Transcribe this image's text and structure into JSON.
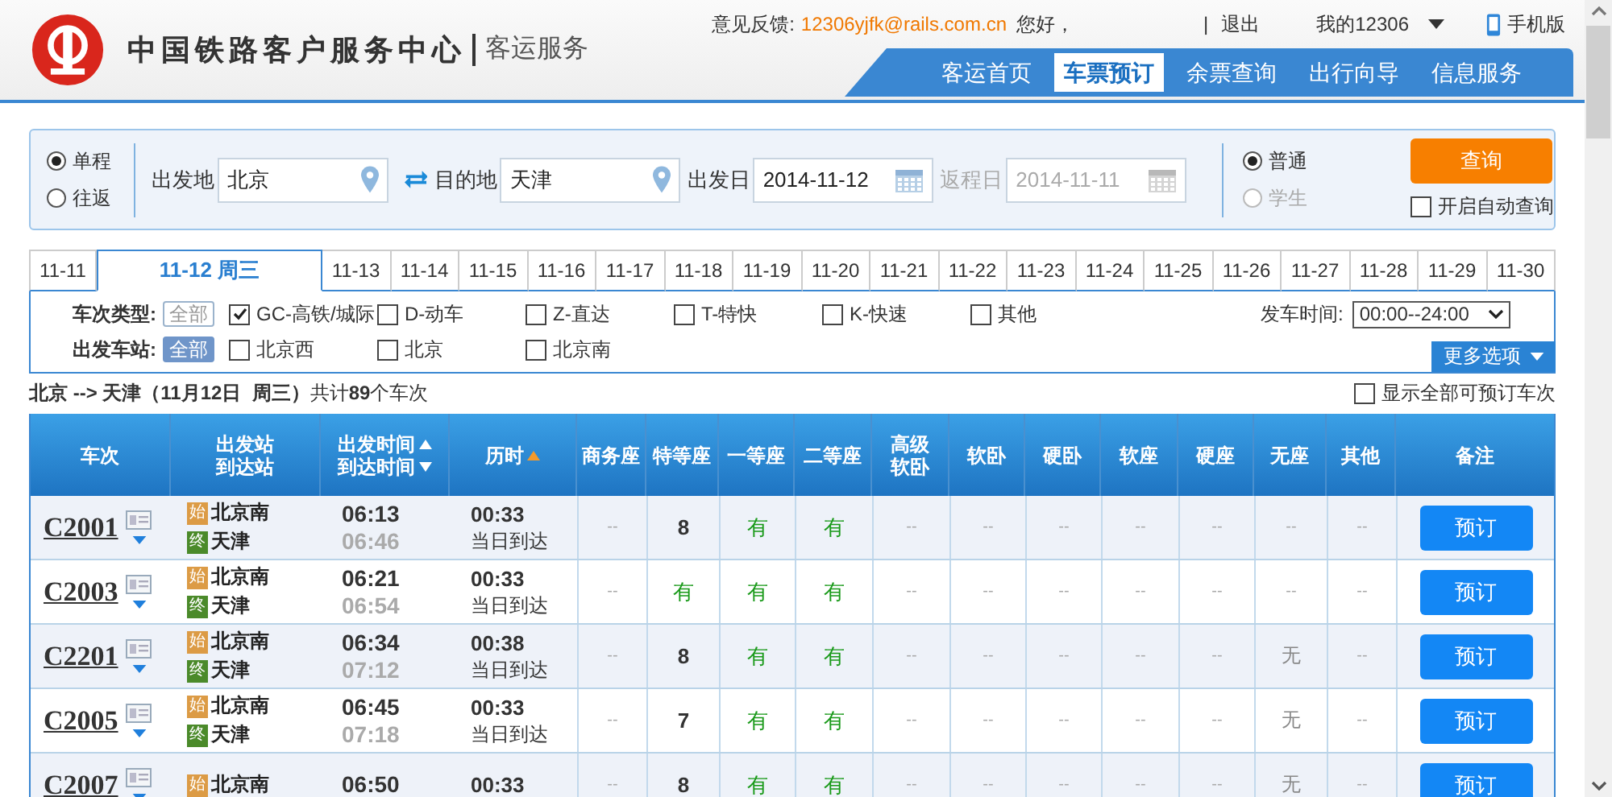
{
  "header": {
    "logo_title": "中国铁路客户服务中心",
    "logo_subtitle": "客运服务",
    "feedback_label": "意见反馈:",
    "feedback_email": "12306yjfk@rails.com.cn",
    "greeting": "您好，",
    "separator": "|",
    "logout": "退出",
    "my_account": "我的12306",
    "mobile": "手机版"
  },
  "nav": [
    {
      "label": "客运首页",
      "selected": false
    },
    {
      "label": "车票预订",
      "selected": true
    },
    {
      "label": "余票查询",
      "selected": false
    },
    {
      "label": "出行向导",
      "selected": false
    },
    {
      "label": "信息服务",
      "selected": false
    }
  ],
  "search": {
    "trip_types": [
      {
        "label": "单程",
        "selected": true
      },
      {
        "label": "往返",
        "selected": false
      }
    ],
    "from": {
      "label": "出发地",
      "value": "北京"
    },
    "to": {
      "label": "目的地",
      "value": "天津"
    },
    "depart_date": {
      "label": "出发日",
      "value": "2014-11-12",
      "disabled": false
    },
    "return_date": {
      "label": "返程日",
      "value": "2014-11-11",
      "disabled": true
    },
    "passenger_types": [
      {
        "label": "普通",
        "selected": true,
        "disabled": false
      },
      {
        "label": "学生",
        "selected": false,
        "disabled": true
      }
    ],
    "query_button": "查询",
    "auto_query": {
      "label": "开启自动查询",
      "checked": false
    }
  },
  "date_tabs": [
    {
      "label": "11-11",
      "selected": false
    },
    {
      "label": "11-12 周三",
      "selected": true
    },
    {
      "label": "11-13",
      "selected": false
    },
    {
      "label": "11-14",
      "selected": false
    },
    {
      "label": "11-15",
      "selected": false
    },
    {
      "label": "11-16",
      "selected": false
    },
    {
      "label": "11-17",
      "selected": false
    },
    {
      "label": "11-18",
      "selected": false
    },
    {
      "label": "11-19",
      "selected": false
    },
    {
      "label": "11-20",
      "selected": false
    },
    {
      "label": "11-21",
      "selected": false
    },
    {
      "label": "11-22",
      "selected": false
    },
    {
      "label": "11-23",
      "selected": false
    },
    {
      "label": "11-24",
      "selected": false
    },
    {
      "label": "11-25",
      "selected": false
    },
    {
      "label": "11-26",
      "selected": false
    },
    {
      "label": "11-27",
      "selected": false
    },
    {
      "label": "11-28",
      "selected": false
    },
    {
      "label": "11-29",
      "selected": false
    },
    {
      "label": "11-30",
      "selected": false
    }
  ],
  "filters": {
    "type_label": "车次类型:",
    "type_all": {
      "label": "全部",
      "selected": false
    },
    "types": [
      {
        "label": "GC-高铁/城际",
        "checked": true
      },
      {
        "label": "D-动车",
        "checked": false
      },
      {
        "label": "Z-直达",
        "checked": false
      },
      {
        "label": "T-特快",
        "checked": false
      },
      {
        "label": "K-快速",
        "checked": false
      },
      {
        "label": "其他",
        "checked": false
      }
    ],
    "time_label": "发车时间:",
    "time_value": "00:00--24:00",
    "station_label": "出发车站:",
    "station_all": {
      "label": "全部",
      "selected": true
    },
    "stations": [
      {
        "label": "北京西",
        "checked": false
      },
      {
        "label": "北京",
        "checked": false
      },
      {
        "label": "北京南",
        "checked": false
      }
    ],
    "more_button": "更多选项"
  },
  "summary": {
    "text": "**北京 --> 天津（11月12日  周三）**共计**89**个车次",
    "show_all": {
      "label": "显示全部可预订车次",
      "checked": false
    }
  },
  "table": {
    "columns": [
      {
        "lines": [
          "车次"
        ]
      },
      {
        "lines": [
          "出发站",
          "到达站"
        ]
      },
      {
        "sort_lines": [
          {
            "text": "出发时间",
            "kind": "up"
          },
          {
            "text": "到达时间",
            "kind": "down"
          }
        ],
        "sorted": false
      },
      {
        "sort_lines": [
          {
            "text": "历时",
            "kind": "up"
          }
        ],
        "sorted": true
      },
      {
        "lines": [
          "商务座"
        ]
      },
      {
        "lines": [
          "特等座"
        ]
      },
      {
        "lines": [
          "一等座"
        ]
      },
      {
        "lines": [
          "二等座"
        ]
      },
      {
        "lines": [
          "高级",
          "软卧"
        ]
      },
      {
        "lines": [
          "软卧"
        ]
      },
      {
        "lines": [
          "硬卧"
        ]
      },
      {
        "lines": [
          "软座"
        ]
      },
      {
        "lines": [
          "硬座"
        ]
      },
      {
        "lines": [
          "无座"
        ]
      },
      {
        "lines": [
          "其他"
        ]
      },
      {
        "lines": [
          "备注"
        ]
      }
    ],
    "rows": [
      {
        "train": "C2001",
        "from_badge": "始",
        "from": "北京南",
        "to_badge": "终",
        "to": "天津",
        "depart": "06:13",
        "arrive": "06:46",
        "duration": "00:33",
        "arrival_day": "当日到达",
        "seats": [
          {
            "text": "--",
            "kind": "empty"
          },
          {
            "text": "8",
            "kind": "count"
          },
          {
            "text": "有",
            "kind": "available"
          },
          {
            "text": "有",
            "kind": "available"
          },
          {
            "text": "--",
            "kind": "empty"
          },
          {
            "text": "--",
            "kind": "empty"
          },
          {
            "text": "--",
            "kind": "empty"
          },
          {
            "text": "--",
            "kind": "empty"
          },
          {
            "text": "--",
            "kind": "empty"
          },
          {
            "text": "--",
            "kind": "empty"
          },
          {
            "text": "--",
            "kind": "empty"
          }
        ],
        "action": "预订"
      },
      {
        "train": "C2003",
        "from_badge": "始",
        "from": "北京南",
        "to_badge": "终",
        "to": "天津",
        "depart": "06:21",
        "arrive": "06:54",
        "duration": "00:33",
        "arrival_day": "当日到达",
        "seats": [
          {
            "text": "--",
            "kind": "empty"
          },
          {
            "text": "有",
            "kind": "available"
          },
          {
            "text": "有",
            "kind": "available"
          },
          {
            "text": "有",
            "kind": "available"
          },
          {
            "text": "--",
            "kind": "empty"
          },
          {
            "text": "--",
            "kind": "empty"
          },
          {
            "text": "--",
            "kind": "empty"
          },
          {
            "text": "--",
            "kind": "empty"
          },
          {
            "text": "--",
            "kind": "empty"
          },
          {
            "text": "--",
            "kind": "empty"
          },
          {
            "text": "--",
            "kind": "empty"
          }
        ],
        "action": "预订"
      },
      {
        "train": "C2201",
        "from_badge": "始",
        "from": "北京南",
        "to_badge": "终",
        "to": "天津",
        "depart": "06:34",
        "arrive": "07:12",
        "duration": "00:38",
        "arrival_day": "当日到达",
        "seats": [
          {
            "text": "--",
            "kind": "empty"
          },
          {
            "text": "8",
            "kind": "count"
          },
          {
            "text": "有",
            "kind": "available"
          },
          {
            "text": "有",
            "kind": "available"
          },
          {
            "text": "--",
            "kind": "empty"
          },
          {
            "text": "--",
            "kind": "empty"
          },
          {
            "text": "--",
            "kind": "empty"
          },
          {
            "text": "--",
            "kind": "empty"
          },
          {
            "text": "--",
            "kind": "empty"
          },
          {
            "text": "无",
            "kind": "none"
          },
          {
            "text": "--",
            "kind": "empty"
          }
        ],
        "action": "预订"
      },
      {
        "train": "C2005",
        "from_badge": "始",
        "from": "北京南",
        "to_badge": "终",
        "to": "天津",
        "depart": "06:45",
        "arrive": "07:18",
        "duration": "00:33",
        "arrival_day": "当日到达",
        "seats": [
          {
            "text": "--",
            "kind": "empty"
          },
          {
            "text": "7",
            "kind": "count"
          },
          {
            "text": "有",
            "kind": "available"
          },
          {
            "text": "有",
            "kind": "available"
          },
          {
            "text": "--",
            "kind": "empty"
          },
          {
            "text": "--",
            "kind": "empty"
          },
          {
            "text": "--",
            "kind": "empty"
          },
          {
            "text": "--",
            "kind": "empty"
          },
          {
            "text": "--",
            "kind": "empty"
          },
          {
            "text": "无",
            "kind": "none"
          },
          {
            "text": "--",
            "kind": "empty"
          }
        ],
        "action": "预订"
      },
      {
        "train": "C2007",
        "from_badge": "始",
        "from": "北京南",
        "depart": "06:50",
        "duration": "00:33",
        "seats": [
          {
            "text": "--",
            "kind": "empty"
          },
          {
            "text": "8",
            "kind": "count"
          },
          {
            "text": "有",
            "kind": "available"
          },
          {
            "text": "有",
            "kind": "available"
          },
          {
            "text": "--",
            "kind": "empty"
          },
          {
            "text": "--",
            "kind": "empty"
          },
          {
            "text": "--",
            "kind": "empty"
          },
          {
            "text": "--",
            "kind": "empty"
          },
          {
            "text": "--",
            "kind": "empty"
          },
          {
            "text": "无",
            "kind": "none"
          },
          {
            "text": "--",
            "kind": "empty"
          }
        ],
        "action": "预订"
      }
    ]
  }
}
